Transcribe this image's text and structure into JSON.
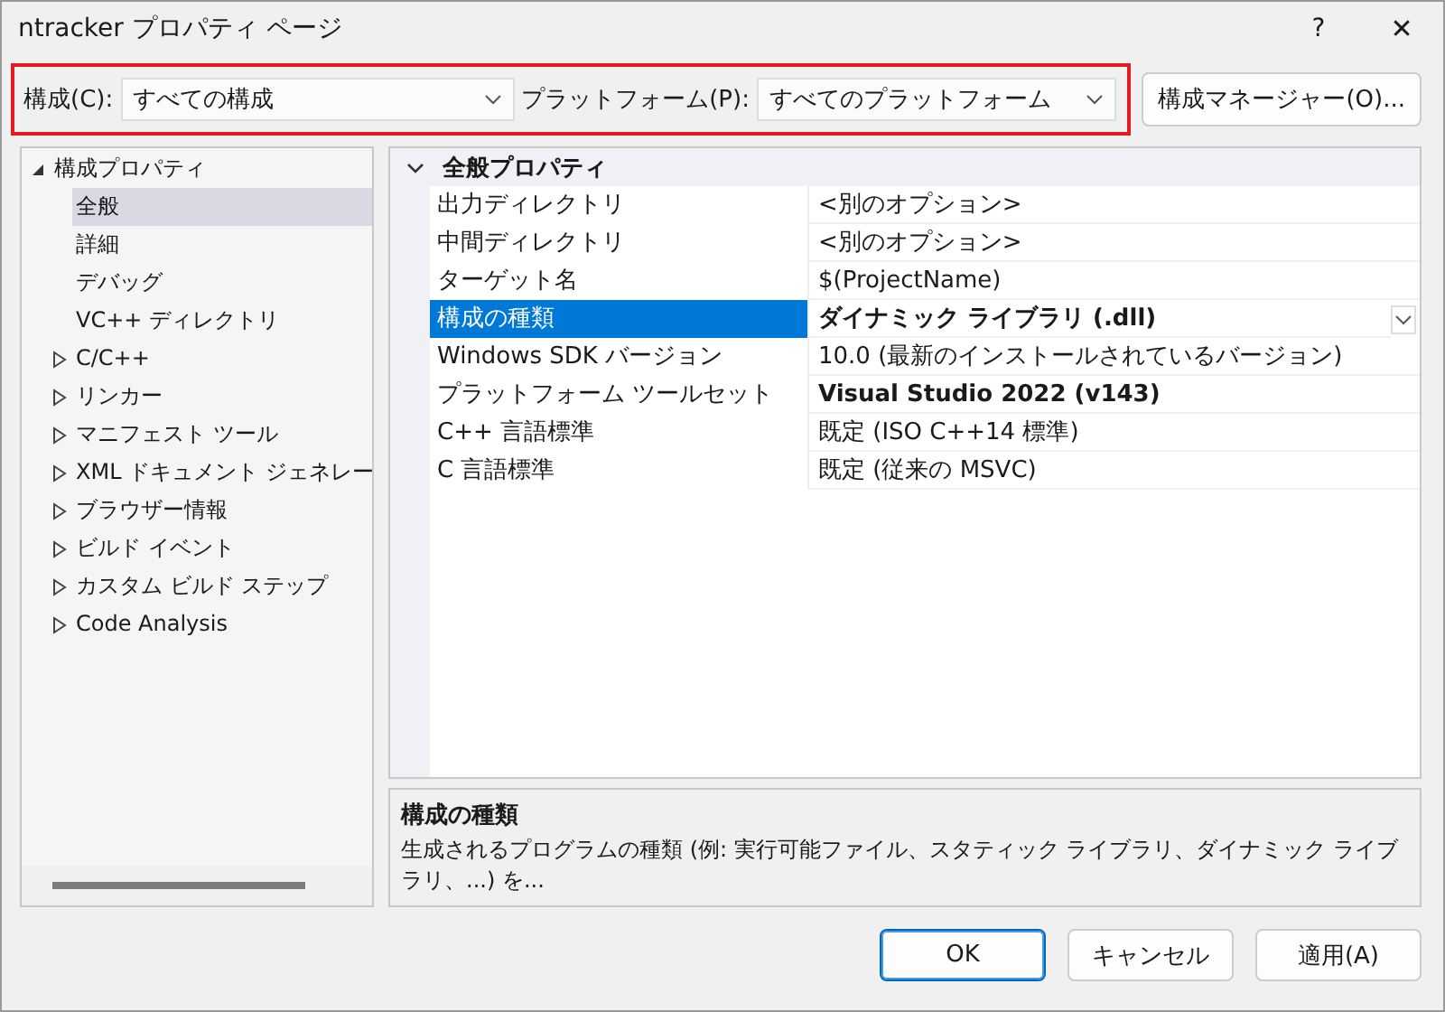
{
  "window": {
    "title": "ntracker プロパティ ページ",
    "help": "?",
    "close": "✕"
  },
  "toolbar": {
    "configuration_label": "構成(C):",
    "configuration_value": "すべての構成",
    "platform_label": "プラットフォーム(P):",
    "platform_value": "すべてのプラットフォーム",
    "manager_button": "構成マネージャー(O)..."
  },
  "tree": [
    {
      "label": "構成プロパティ",
      "expanded": true,
      "selected": false,
      "children": [
        {
          "label": "全般",
          "selected": true
        },
        {
          "label": "詳細",
          "selected": false
        },
        {
          "label": "デバッグ",
          "selected": false
        },
        {
          "label": "VC++ ディレクトリ",
          "selected": false
        },
        {
          "label": "C/C++",
          "expanded": false,
          "selected": false
        },
        {
          "label": "リンカー",
          "expanded": false,
          "selected": false
        },
        {
          "label": "マニフェスト ツール",
          "expanded": false,
          "selected": false
        },
        {
          "label": "XML ドキュメント ジェネレー",
          "expanded": false,
          "selected": false
        },
        {
          "label": "ブラウザー情報",
          "expanded": false,
          "selected": false
        },
        {
          "label": "ビルド イベント",
          "expanded": false,
          "selected": false
        },
        {
          "label": "カスタム ビルド ステップ",
          "expanded": false,
          "selected": false
        },
        {
          "label": "Code Analysis",
          "expanded": false,
          "selected": false
        }
      ]
    }
  ],
  "grid": {
    "group": "全般プロパティ",
    "expanded": true,
    "rows": [
      {
        "name": "出力ディレクトリ",
        "value": "<別のオプション>",
        "modified": false,
        "selected": false
      },
      {
        "name": "中間ディレクトリ",
        "value": "<別のオプション>",
        "modified": false,
        "selected": false
      },
      {
        "name": "ターゲット名",
        "value": "$(ProjectName)",
        "modified": false,
        "selected": false
      },
      {
        "name": "構成の種類",
        "value": "ダイナミック ライブラリ (.dll)",
        "modified": true,
        "selected": true
      },
      {
        "name": "Windows SDK バージョン",
        "value": "10.0 (最新のインストールされているバージョン)",
        "modified": false,
        "selected": false
      },
      {
        "name": "プラットフォーム ツールセット",
        "value": "Visual Studio 2022 (v143)",
        "modified": true,
        "selected": false
      },
      {
        "name": "C++ 言語標準",
        "value": "既定 (ISO C++14 標準)",
        "modified": false,
        "selected": false
      },
      {
        "name": "C 言語標準",
        "value": "既定 (従来の MSVC)",
        "modified": false,
        "selected": false
      }
    ]
  },
  "description": {
    "title": "構成の種類",
    "text": "生成されるプログラムの種類 (例: 実行可能ファイル、スタティック ライブラリ、ダイナミック ライブラリ、...) を..."
  },
  "buttons": [
    {
      "label": "OK",
      "default": true
    },
    {
      "label": "キャンセル",
      "default": false
    },
    {
      "label": "適用(A)",
      "default": false
    }
  ]
}
